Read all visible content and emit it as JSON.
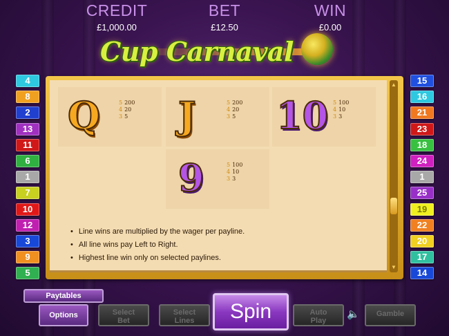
{
  "hud": {
    "credit_label": "CREDIT",
    "credit_value": "£1,000.00",
    "bet_label": "BET",
    "bet_value": "£12.50",
    "win_label": "WIN",
    "win_value": "£0.00"
  },
  "logo": {
    "title": "Cup Carnaval"
  },
  "paylines_left": [
    {
      "number": "4",
      "color": "#2ec8e0",
      "text_color": "#ffffff"
    },
    {
      "number": "8",
      "color": "#f0a020",
      "text_color": "#ffffff"
    },
    {
      "number": "2",
      "color": "#2040d0",
      "text_color": "#ffffff"
    },
    {
      "number": "13",
      "color": "#a030c0",
      "text_color": "#ffffff"
    },
    {
      "number": "11",
      "color": "#d01818",
      "text_color": "#ffffff"
    },
    {
      "number": "6",
      "color": "#30b040",
      "text_color": "#ffffff"
    },
    {
      "number": "1",
      "color": "#a8a8a8",
      "text_color": "#ffffff"
    },
    {
      "number": "7",
      "color": "#c8d020",
      "text_color": "#ffffff"
    },
    {
      "number": "10",
      "color": "#e01818",
      "text_color": "#ffffff"
    },
    {
      "number": "12",
      "color": "#c020b0",
      "text_color": "#ffffff"
    },
    {
      "number": "3",
      "color": "#1848d8",
      "text_color": "#ffffff"
    },
    {
      "number": "9",
      "color": "#f09020",
      "text_color": "#ffffff"
    },
    {
      "number": "5",
      "color": "#30b050",
      "text_color": "#ffffff"
    }
  ],
  "paylines_right": [
    {
      "number": "15",
      "color": "#2050e0",
      "text_color": "#ffffff"
    },
    {
      "number": "16",
      "color": "#2ec8e0",
      "text_color": "#ffffff"
    },
    {
      "number": "21",
      "color": "#f07820",
      "text_color": "#ffffff"
    },
    {
      "number": "23",
      "color": "#d01818",
      "text_color": "#ffffff"
    },
    {
      "number": "18",
      "color": "#38c040",
      "text_color": "#ffffff"
    },
    {
      "number": "24",
      "color": "#d020c0",
      "text_color": "#ffffff"
    },
    {
      "number": "1",
      "color": "#a8a8a8",
      "text_color": "#ffffff"
    },
    {
      "number": "25",
      "color": "#9830c8",
      "text_color": "#ffffff"
    },
    {
      "number": "19",
      "color": "#f0f020",
      "text_color": "#7a7a00"
    },
    {
      "number": "22",
      "color": "#f08020",
      "text_color": "#ffffff"
    },
    {
      "number": "20",
      "color": "#f0d020",
      "text_color": "#ffffff"
    },
    {
      "number": "17",
      "color": "#30c0a0",
      "text_color": "#ffffff"
    },
    {
      "number": "14",
      "color": "#1848d8",
      "text_color": "#ffffff"
    }
  ],
  "paytable": {
    "symbols": [
      {
        "symbol": "Q",
        "style": "gold",
        "pays": [
          {
            "count": "5",
            "amount": "200"
          },
          {
            "count": "4",
            "amount": "20"
          },
          {
            "count": "3",
            "amount": "5"
          }
        ]
      },
      {
        "symbol": "J",
        "style": "gold",
        "pays": [
          {
            "count": "5",
            "amount": "200"
          },
          {
            "count": "4",
            "amount": "20"
          },
          {
            "count": "3",
            "amount": "5"
          }
        ]
      },
      {
        "symbol": "10",
        "style": "purple",
        "pays": [
          {
            "count": "5",
            "amount": "100"
          },
          {
            "count": "4",
            "amount": "10"
          },
          {
            "count": "3",
            "amount": "3"
          }
        ]
      },
      {
        "symbol": "9",
        "style": "purple",
        "pays": [
          {
            "count": "5",
            "amount": "100"
          },
          {
            "count": "4",
            "amount": "10"
          },
          {
            "count": "3",
            "amount": "3"
          }
        ]
      }
    ],
    "rules": [
      "Line wins are multiplied by the wager per payline.",
      "All line wins pay Left to Right.",
      "Highest line win only on selected paylines."
    ]
  },
  "controls": {
    "paytables_label": "Paytables",
    "options_label": "Options",
    "select_bet_label": "Select Bet",
    "select_lines_label": "Select Lines",
    "spin_label": "Spin",
    "auto_play_label": "Auto Play",
    "gamble_label": "Gamble",
    "speaker_icon": "speaker-icon"
  }
}
